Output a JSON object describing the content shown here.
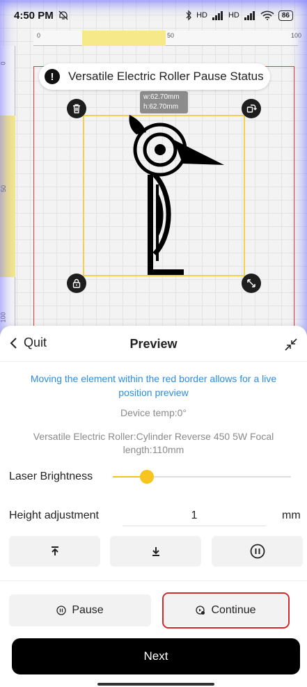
{
  "status_bar": {
    "time": "4:50 PM",
    "battery": "86",
    "signal_label": "HD"
  },
  "canvas": {
    "ruler_top_ticks": [
      "0",
      "50",
      "100"
    ],
    "ruler_left_ticks": [
      "0",
      "50",
      "100"
    ],
    "size_tip": {
      "width": "w:62.70mm",
      "height": "h:62.70mm"
    },
    "status_notice": {
      "icon": "!",
      "text": "Versatile Electric Roller Pause Status"
    }
  },
  "panel": {
    "quit_label": "Quit",
    "title": "Preview",
    "hint": "Moving the element within the red border allows for a live position preview",
    "device_temp": "Device temp:0°",
    "device_info": "Versatile Electric Roller:Cylinder Reverse 450 5W Focal length:110mm",
    "brightness": {
      "label": "Laser Brightness",
      "value_fraction": 0.19
    },
    "height": {
      "label": "Height adjustment",
      "value": "1",
      "unit": "mm"
    },
    "move_buttons": [
      "move-up-icon",
      "move-down-icon",
      "pause-circle-icon"
    ],
    "pause_label": "Pause",
    "continue_label": "Continue",
    "next_label": "Next"
  },
  "colors": {
    "accent_yellow": "#f7c51e",
    "hint_blue": "#2a8de0",
    "border_red": "#e23a3a"
  }
}
